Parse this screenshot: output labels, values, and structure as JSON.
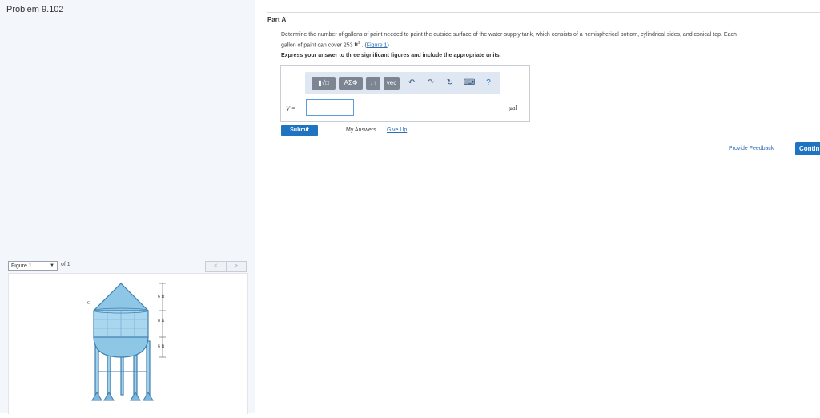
{
  "problem": {
    "title": "Problem 9.102"
  },
  "part": {
    "title": "Part A",
    "question_line1": "Determine the number of gallons of paint needed to paint the outside surface of the water-supply tank, which consists of a hemispherical bottom, cylindrical sides, and conical top. Each",
    "question_line2_prefix": "gallon of paint can cover 253 ",
    "question_unit": "ft",
    "question_unit_exp": "2",
    "question_sep": " . (",
    "figure_link": "Figure 1",
    "question_close": ")",
    "instruction": "Express your answer to three significant figures and include the appropriate units."
  },
  "toolbar": {
    "template_label": "▮√□",
    "greek_label": "ΑΣΦ",
    "arrows_label": "↓↑",
    "vec_label": "vec",
    "undo_icon": "↶",
    "redo_icon": "↷",
    "reset_icon": "↻",
    "keyboard_icon": "⌨",
    "help_label": "?"
  },
  "answer": {
    "variable": "V =",
    "value": "",
    "unit": "gal"
  },
  "actions": {
    "submit": "Submit",
    "my_answers": "My Answers",
    "give_up": "Give Up",
    "feedback": "Provide Feedback",
    "continue": "Contin"
  },
  "figure_nav": {
    "selected": "Figure 1",
    "of": "of 1",
    "prev": "<",
    "next": ">"
  },
  "figure": {
    "label_c": "C",
    "dim_top": "6 ft",
    "dim_mid": "8 ft",
    "dim_bottom": "6 ft"
  },
  "colors": {
    "accent": "#1f73c0",
    "tank_fill": "#8ec7e6",
    "tank_stroke": "#3f7fb0"
  }
}
